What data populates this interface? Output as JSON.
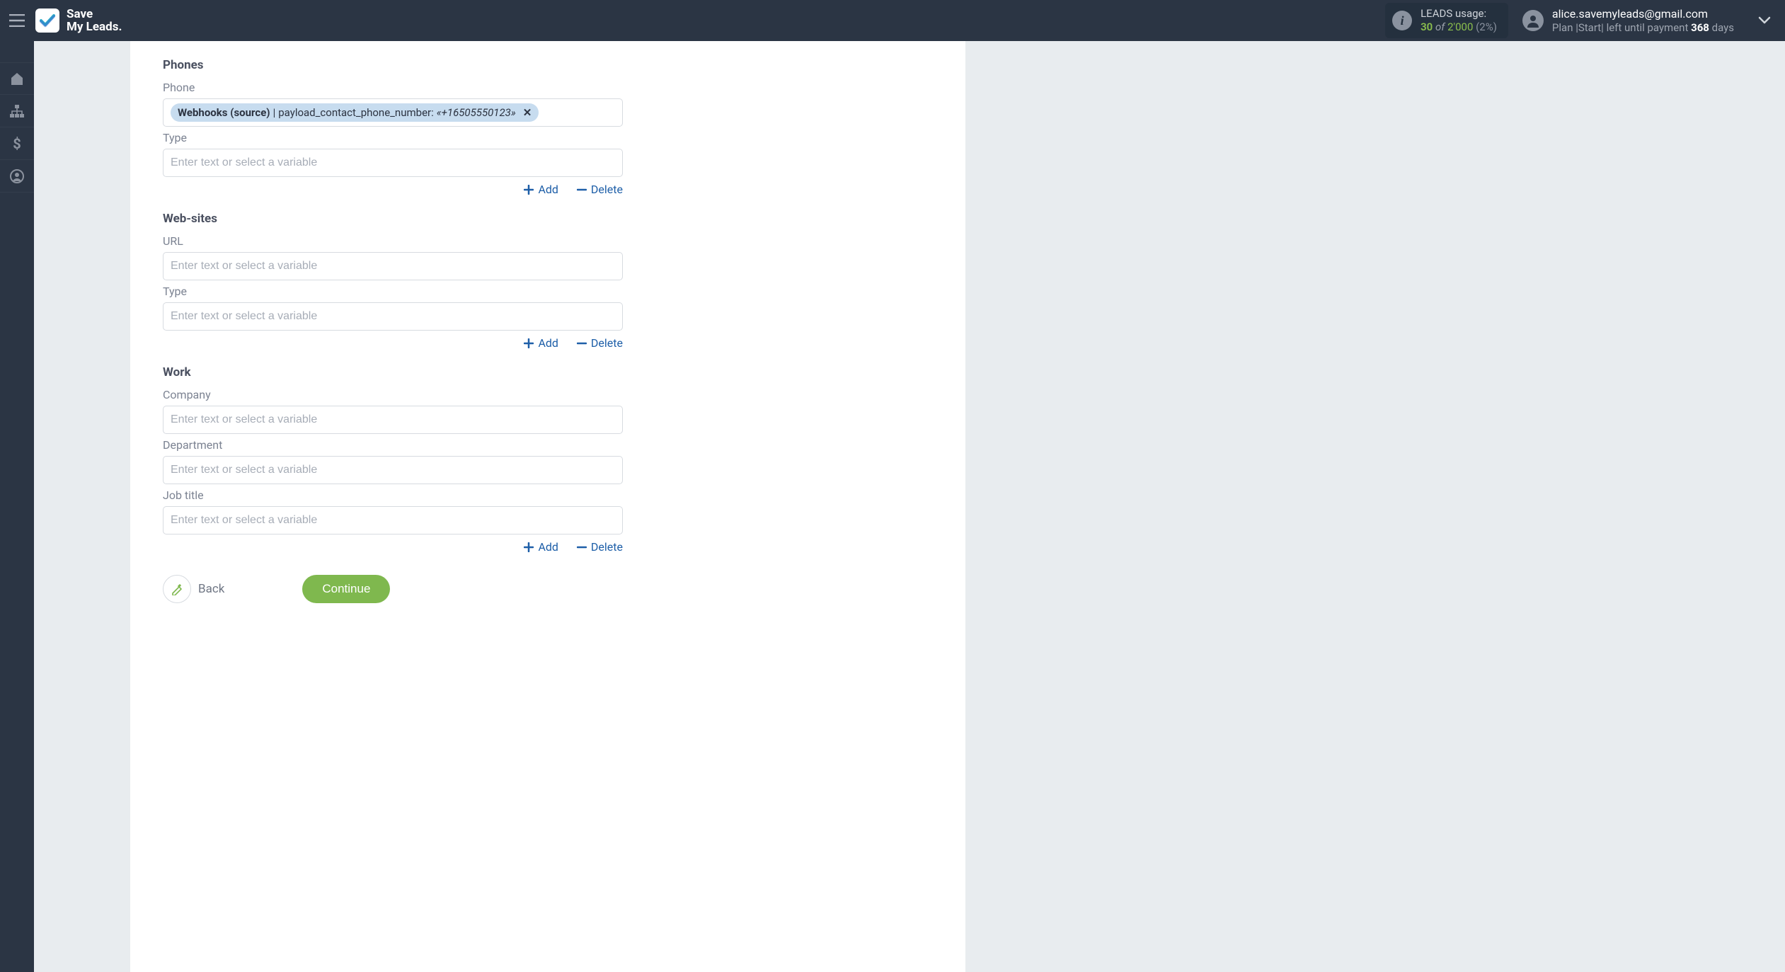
{
  "brand": {
    "line1": "Save",
    "line2": "My Leads."
  },
  "usage": {
    "title": "LEADS usage:",
    "used": "30",
    "of": "of",
    "max": "2'000",
    "pct": "(2%)"
  },
  "account": {
    "email": "alice.savemyleads@gmail.com",
    "plan_prefix": "Plan |Start| left until payment ",
    "plan_days": "368",
    "plan_suffix": " days"
  },
  "form": {
    "placeholder": "Enter text or select a variable",
    "sections": {
      "phones": {
        "heading": "Phones",
        "phone_label": "Phone",
        "type_label": "Type"
      },
      "websites": {
        "heading": "Web-sites",
        "url_label": "URL",
        "type_label": "Type"
      },
      "work": {
        "heading": "Work",
        "company_label": "Company",
        "department_label": "Department",
        "jobtitle_label": "Job title"
      }
    },
    "chip": {
      "source": "Webhooks (source)",
      "sep": " | ",
      "field": "payload_contact_phone_number: ",
      "value": "«+16505550123»"
    },
    "actions": {
      "add": "Add",
      "delete": "Delete"
    },
    "footer": {
      "back": "Back",
      "continue": "Continue"
    }
  }
}
